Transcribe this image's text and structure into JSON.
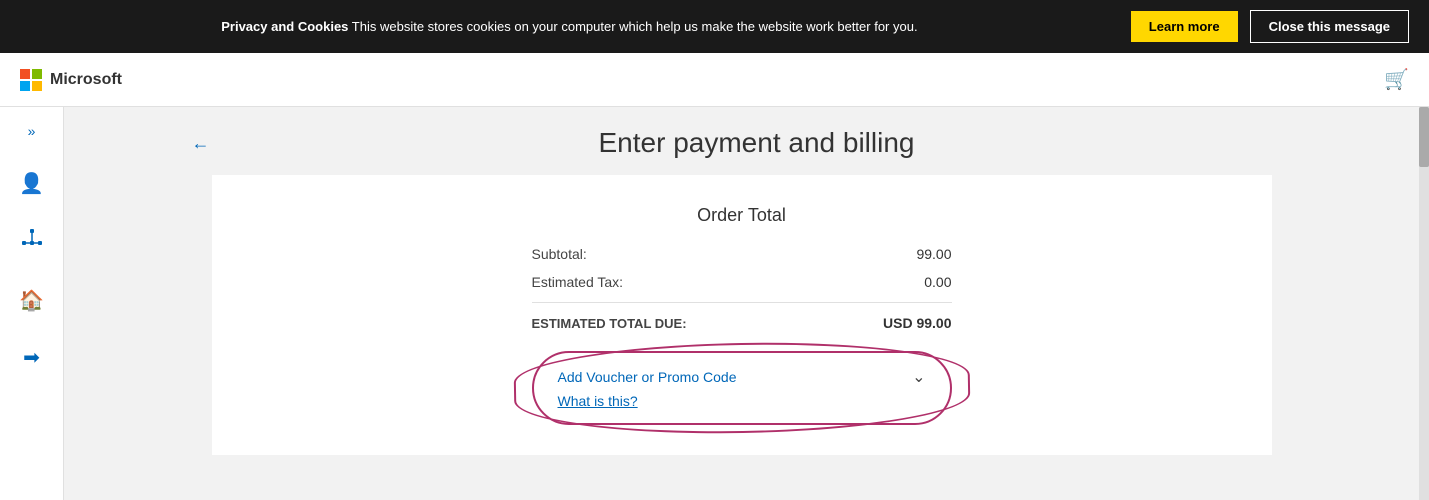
{
  "cookie_banner": {
    "text_bold": "Privacy and Cookies",
    "text_regular": " This website stores cookies on your computer which help us make the website work better for you.",
    "learn_more_label": "Learn more",
    "close_label": "Close this message"
  },
  "header": {
    "logo_text": "Microsoft",
    "cart_aria": "Shopping cart"
  },
  "sidebar": {
    "chevron_label": ">>",
    "icons": [
      "person-icon",
      "network-icon",
      "home-icon",
      "arrow-icon"
    ]
  },
  "page": {
    "back_label": "←",
    "title": "Enter payment and billing"
  },
  "order": {
    "section_title": "Order Total",
    "subtotal_label": "Subtotal:",
    "subtotal_value": "99.00",
    "tax_label": "Estimated Tax:",
    "tax_value": "0.00",
    "total_label": "ESTIMATED TOTAL DUE:",
    "total_value": "USD 99.00"
  },
  "voucher": {
    "link_label": "Add Voucher or Promo Code",
    "what_label": "What is this?"
  }
}
